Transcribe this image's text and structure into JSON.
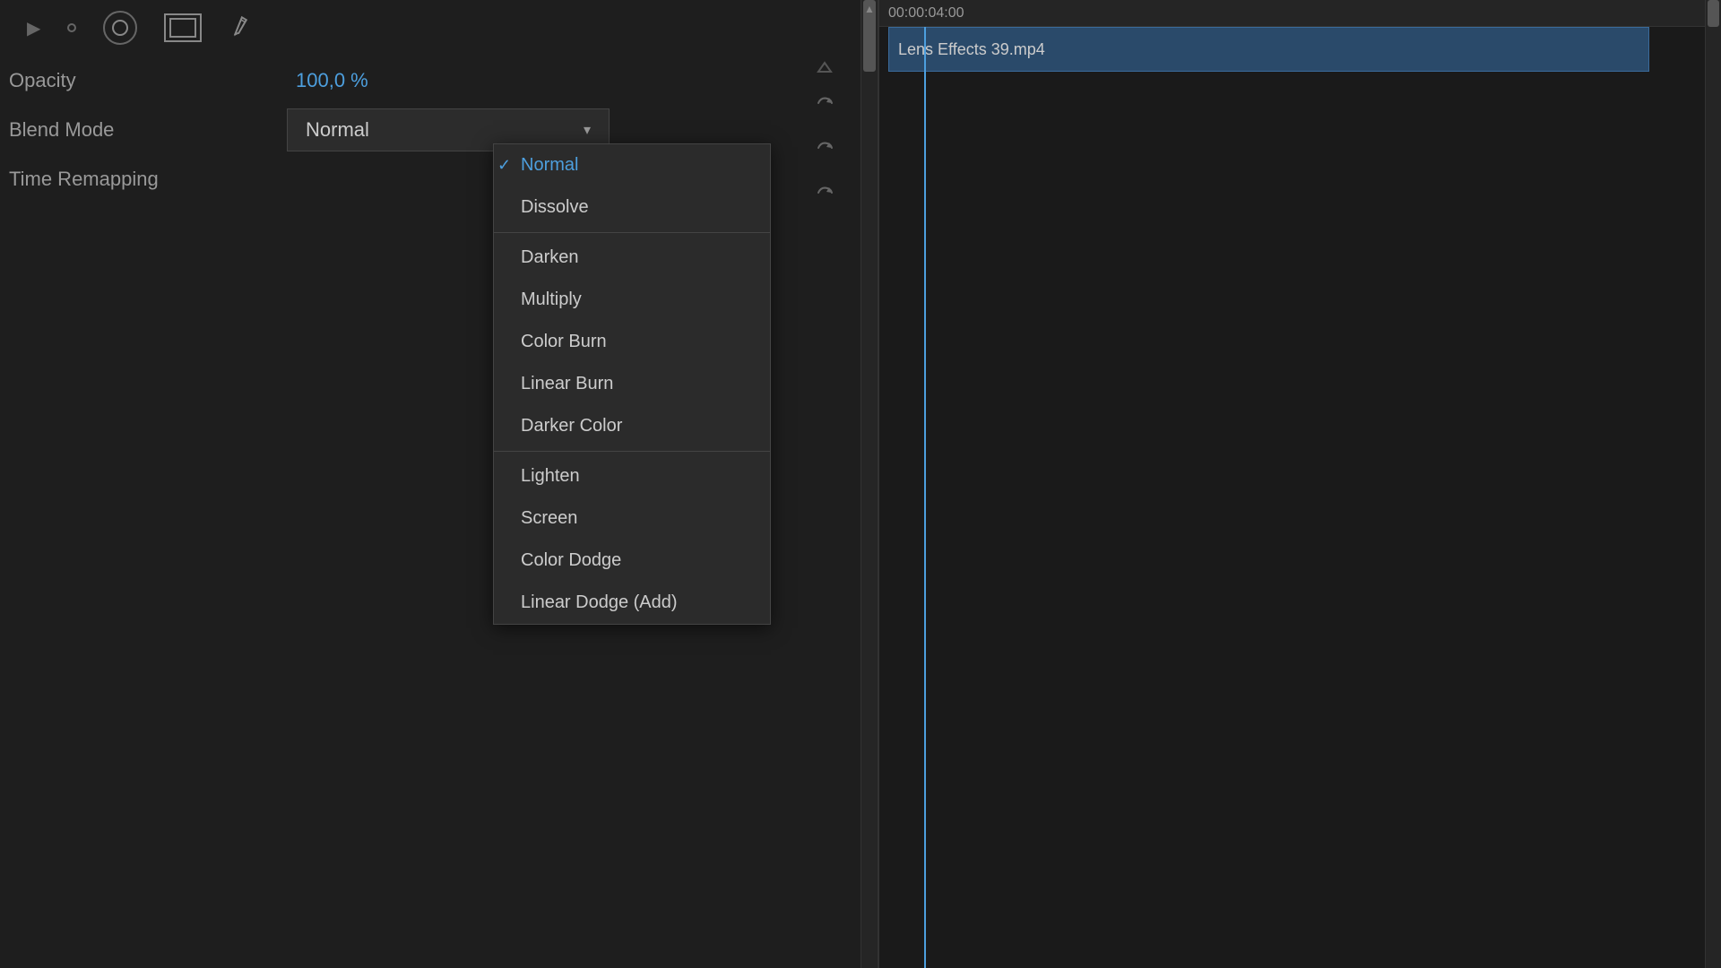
{
  "toolbar": {
    "icons": [
      "○",
      "▭",
      "✒"
    ]
  },
  "properties": {
    "opacity_label": "Opacity",
    "blend_mode_label": "Blend Mode",
    "time_remap_label": "Time Remapping",
    "opacity_value": "100,0 %",
    "blend_mode_value": "Normal"
  },
  "dropdown": {
    "selected_item": "Normal",
    "items": [
      {
        "label": "Normal",
        "selected": true,
        "group": 1
      },
      {
        "label": "Dissolve",
        "selected": false,
        "group": 1
      },
      {
        "label": "Darken",
        "selected": false,
        "group": 2
      },
      {
        "label": "Multiply",
        "selected": false,
        "group": 2
      },
      {
        "label": "Color Burn",
        "selected": false,
        "group": 2
      },
      {
        "label": "Linear Burn",
        "selected": false,
        "group": 2
      },
      {
        "label": "Darker Color",
        "selected": false,
        "group": 2
      },
      {
        "label": "Lighten",
        "selected": false,
        "group": 3
      },
      {
        "label": "Screen",
        "selected": false,
        "group": 3
      },
      {
        "label": "Color Dodge",
        "selected": false,
        "group": 3
      },
      {
        "label": "Linear Dodge (Add)",
        "selected": false,
        "group": 3
      }
    ]
  },
  "timeline": {
    "time_label": "00:00:04:00",
    "clip_label": "Lens Effects 39.mp4"
  },
  "colors": {
    "accent": "#4d9fde",
    "bg_dark": "#1a1a1a",
    "bg_panel": "#1e1e1e",
    "bg_dropdown": "#2b2b2b",
    "text_normal": "#cccccc",
    "text_muted": "#999999",
    "clip_bg": "#2a4a6a"
  }
}
